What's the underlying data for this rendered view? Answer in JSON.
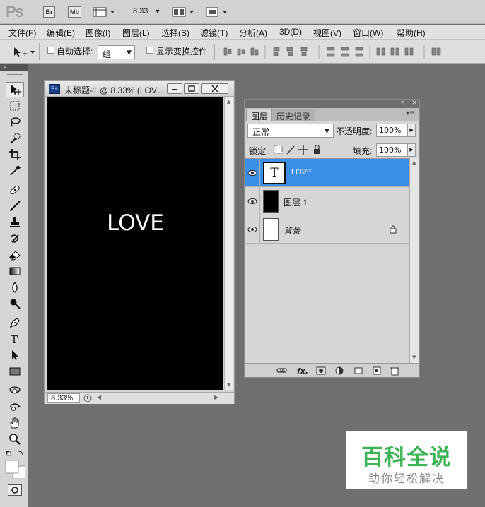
{
  "app": {
    "logo": "Ps",
    "bridge_btn": "Br",
    "minibridge_btn": "Mb",
    "zoom": "8.33"
  },
  "menu": [
    "文件(F)",
    "编辑(E)",
    "图像(I)",
    "图层(L)",
    "选择(S)",
    "滤镜(T)",
    "分析(A)",
    "3D(D)",
    "视图(V)",
    "窗口(W)",
    "帮助(H)"
  ],
  "options": {
    "auto_select_label": "自动选择:",
    "auto_select_value": "组",
    "show_transform_label": "显示变换控件"
  },
  "tools": [
    "move-tool-icon",
    "marquee-tool-icon",
    "lasso-tool-icon",
    "quick-select-tool-icon",
    "crop-tool-icon",
    "eyedropper-tool-icon",
    "healing-brush-tool-icon",
    "brush-tool-icon",
    "clone-stamp-tool-icon",
    "history-brush-tool-icon",
    "eraser-tool-icon",
    "gradient-tool-icon",
    "blur-tool-icon",
    "dodge-tool-icon",
    "pen-tool-icon",
    "type-tool-icon",
    "path-select-tool-icon",
    "rectangle-tool-icon",
    "3d-rotate-tool-icon",
    "3d-orbit-tool-icon",
    "hand-tool-icon",
    "zoom-tool-icon"
  ],
  "document": {
    "title": "未标题-1 @ 8.33% (LOV...",
    "canvas_text": "LOVE",
    "zoom": "8.33%"
  },
  "layers_panel": {
    "tab_layers": "图层",
    "tab_history": "历史记录",
    "blend_mode": "正常",
    "opacity_label": "不透明度:",
    "opacity_value": "100%",
    "lock_label": "锁定:",
    "fill_label": "填充:",
    "fill_value": "100%",
    "layers": [
      {
        "name": "LOVE",
        "thumb": "T",
        "selected": true
      },
      {
        "name": "图层 1",
        "selected": false
      },
      {
        "name": "背景",
        "selected": false
      }
    ]
  },
  "watermark": {
    "title": "百科全说",
    "subtitle": "助你轻松解决"
  },
  "colors": {
    "workspace": "#6f6f6f",
    "selected_layer": "#3a8ee6",
    "watermark_green": "#3cb454"
  }
}
